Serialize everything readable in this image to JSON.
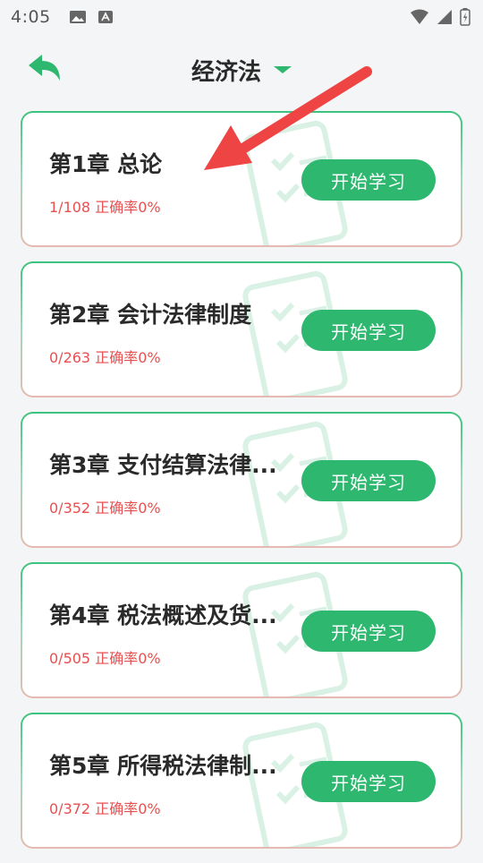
{
  "status_bar": {
    "time": "4:05",
    "left_icons": [
      "image-icon",
      "font-a-icon"
    ],
    "right_icons": [
      "wifi-icon",
      "signal-icon",
      "battery-icon"
    ]
  },
  "header": {
    "title": "经济法",
    "back_icon": "back-arrow-icon",
    "dropdown_icon": "caret-down-icon"
  },
  "chapters": [
    {
      "title": "第1章 总论",
      "stats": "1/108 正确率0%",
      "button": "开始学习"
    },
    {
      "title": "第2章 会计法律制度",
      "stats": "0/263 正确率0%",
      "button": "开始学习"
    },
    {
      "title": "第3章 支付结算法律...",
      "stats": "0/352 正确率0%",
      "button": "开始学习"
    },
    {
      "title": "第4章 税法概述及货...",
      "stats": "0/505 正确率0%",
      "button": "开始学习"
    },
    {
      "title": "第5章 所得税法律制...",
      "stats": "0/372 正确率0%",
      "button": "开始学习"
    }
  ],
  "colors": {
    "accent": "#2eb86f",
    "stats_red": "#e84f4f",
    "annotation_arrow": "#ee4444"
  }
}
